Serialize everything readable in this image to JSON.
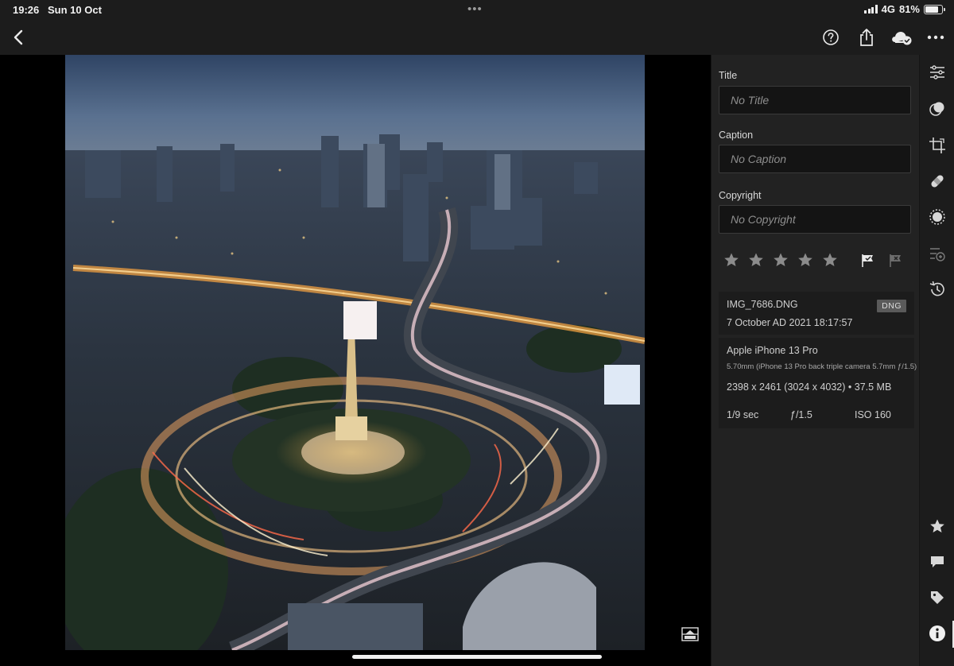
{
  "status_bar": {
    "time": "19:26",
    "date": "Sun 10 Oct",
    "network": "4G",
    "battery": "81%",
    "battery_level": 0.81
  },
  "toolbar": {
    "back_icon": "chevron-left-icon",
    "help_icon": "help-icon",
    "share_icon": "share-icon",
    "cloud_icon": "cloud-synced-icon",
    "more_icon": "more-icon"
  },
  "photo": {
    "description_icon": "photo-icon",
    "compare_icon": "before-after-icon"
  },
  "info_panel": {
    "title_label": "Title",
    "title_placeholder": "No Title",
    "caption_label": "Caption",
    "caption_placeholder": "No Caption",
    "copyright_label": "Copyright",
    "copyright_placeholder": "No Copyright",
    "rating": 0,
    "rating_max": 5,
    "flag_state": "unflagged",
    "file_name": "IMG_7686.DNG",
    "file_type_badge": "DNG",
    "capture_date": "7 October AD 2021 18:17:57",
    "camera": "Apple iPhone 13 Pro",
    "lens": "5.70mm (iPhone 13 Pro back triple camera 5.7mm ƒ/1.5)",
    "dimensions_size": "2398 x 2461 (3024 x 4032) • 37.5 MB",
    "shutter": "1/9 sec",
    "aperture": "ƒ/1.5",
    "iso": "ISO 160"
  },
  "right_rail": {
    "items": [
      "edit-sliders-icon",
      "presets-icon",
      "crop-icon",
      "healing-icon",
      "masking-icon",
      "versions-icon",
      "history-icon",
      "rate-icon",
      "comment-icon",
      "keyword-icon",
      "info-icon"
    ],
    "active": "info-icon"
  },
  "colors": {
    "toolbar_bg": "#1c1c1c",
    "panel_bg": "#222222",
    "field_bg": "#141414",
    "accent_text": "#e6e6e6"
  }
}
